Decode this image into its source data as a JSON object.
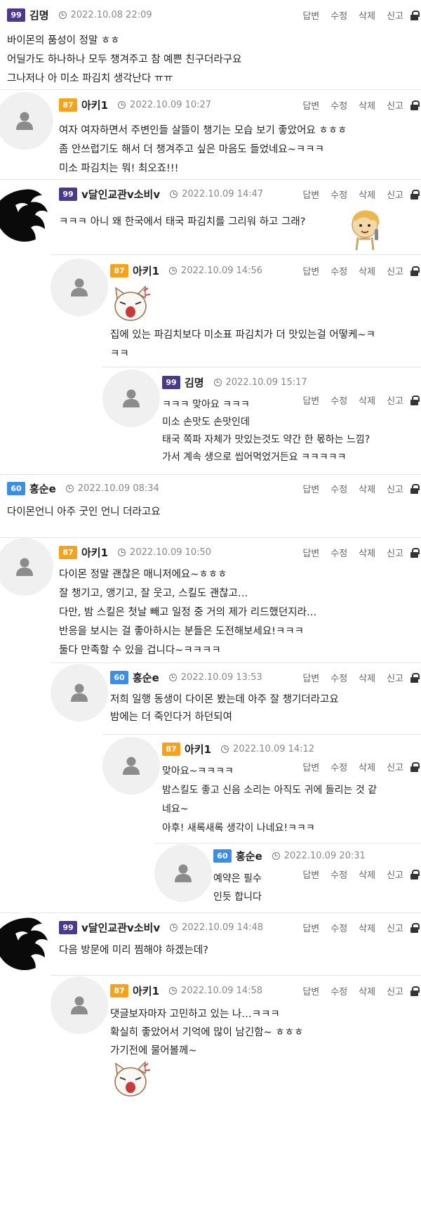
{
  "actions": {
    "reply": "답변",
    "edit": "수정",
    "delete": "삭제",
    "report": "신고"
  },
  "colors": {
    "lvl99": "#4b3a8c",
    "lvl87": "#f7a21b",
    "lvl60": "#3a8ee6",
    "separator": "#e5e5e5"
  },
  "comments": [
    {
      "id": "c1",
      "level": "99",
      "nick": "김명",
      "time": "2022.10.08 22:09",
      "lines": [
        "바이몬의 품성이 정말 ㅎㅎ",
        "어딜가도 하나하나 모두 챙겨주고 참 예쁜 친구더라구요",
        "그나저나 아 미소 파김치 생각난다 ㅠㅠ"
      ]
    },
    {
      "id": "c2",
      "level": "87",
      "nick": "아키1",
      "time": "2022.10.09 10:27",
      "lines": [
        "여자 여자하면서 주변인들 살뜰이 챙기는 모습 보기 좋았어요 ㅎㅎㅎ",
        "좀 안쓰럽기도 해서 더 챙겨주고 싶은 마음도 들었네요~ㅋㅋㅋ",
        "미소 파김치는 뭐! 최오죠!!!"
      ]
    },
    {
      "id": "c3",
      "level": "99",
      "nick": "v달인교관v소비v",
      "time": "2022.10.09 14:47",
      "lines": [
        "ㅋㅋㅋ 아니 왜 한국에서 태국 파김치를 그리워 하고 그래?"
      ]
    },
    {
      "id": "c4",
      "level": "87",
      "nick": "아키1",
      "time": "2022.10.09 14:56",
      "lines": [
        "집에 있는 파김치보다 미소표 파김치가 더 맛있는걸 어떻케~ㅋㅋㅋ"
      ]
    },
    {
      "id": "c5",
      "level": "99",
      "nick": "김명",
      "time": "2022.10.09 15:17",
      "lines": [
        "ㅋㅋㅋ 맞아요 ㅋㅋㅋ",
        "미소 손맛도 손맛인데",
        "태국 쪽파 자체가 맛있는것도 약간 한 몫하는 느낌?",
        "가서 계속 생으로 씹어먹었거든요 ㅋㅋㅋㅋㅋ"
      ]
    },
    {
      "id": "c6",
      "level": "60",
      "nick": "홍순e",
      "time": "2022.10.09 08:34",
      "lines": [
        "다이몬언니 아주 굿인 언니 더라고요"
      ]
    },
    {
      "id": "c7",
      "level": "87",
      "nick": "아키1",
      "time": "2022.10.09 10:50",
      "lines": [
        "다이몬 정말 괜찮은 매니저에요~ㅎㅎㅎ",
        "잘 챙기고, 앵기고, 잘 웃고, 스킬도 괜찮고…",
        "다만, 밤 스킬은 첫날 빼고 일정 중 거의 제가 리드했던지라…",
        "반응을 보시는 걸 좋아하시는 분들은 도전해보세요!ㅋㅋㅋ",
        "둘다 만족할 수 있을 겁니다~ㅋㅋㅋㅋ"
      ]
    },
    {
      "id": "c8",
      "level": "60",
      "nick": "홍순e",
      "time": "2022.10.09 13:53",
      "lines": [
        "저희 일행 동생이 다이몬 봤는데 아주 잘 챙기더라고요",
        "밤에는 더 죽인다거 하던되여"
      ]
    },
    {
      "id": "c9",
      "level": "87",
      "nick": "아키1",
      "time": "2022.10.09 14:12",
      "lines": [
        "맞아요~ㅋㅋㅋㅋ",
        "밤스킬도 좋고 신음 소리는 아직도 귀에 들리는 것 같네요~",
        "아후! 새록새록 생각이 나네요!ㅋㅋㅋ"
      ]
    },
    {
      "id": "c10",
      "level": "60",
      "nick": "홍순e",
      "time": "2022.10.09 20:31",
      "lines": [
        "예약은 필수",
        "인듯 합니다"
      ]
    },
    {
      "id": "c11",
      "level": "99",
      "nick": "v달인교관v소비v",
      "time": "2022.10.09 14:48",
      "lines": [
        "다음 방문에 미리 찜해야 하겠는데?"
      ]
    },
    {
      "id": "c12",
      "level": "87",
      "nick": "아키1",
      "time": "2022.10.09 14:58",
      "lines": [
        "댓글보자마자 고민하고 있는 나…ㅋㅋㅋ",
        "확실히 좋았어서 기억에 많이 남긴함~ ㅎㅎㅎ",
        "가기전에 물어볼께~"
      ]
    }
  ]
}
